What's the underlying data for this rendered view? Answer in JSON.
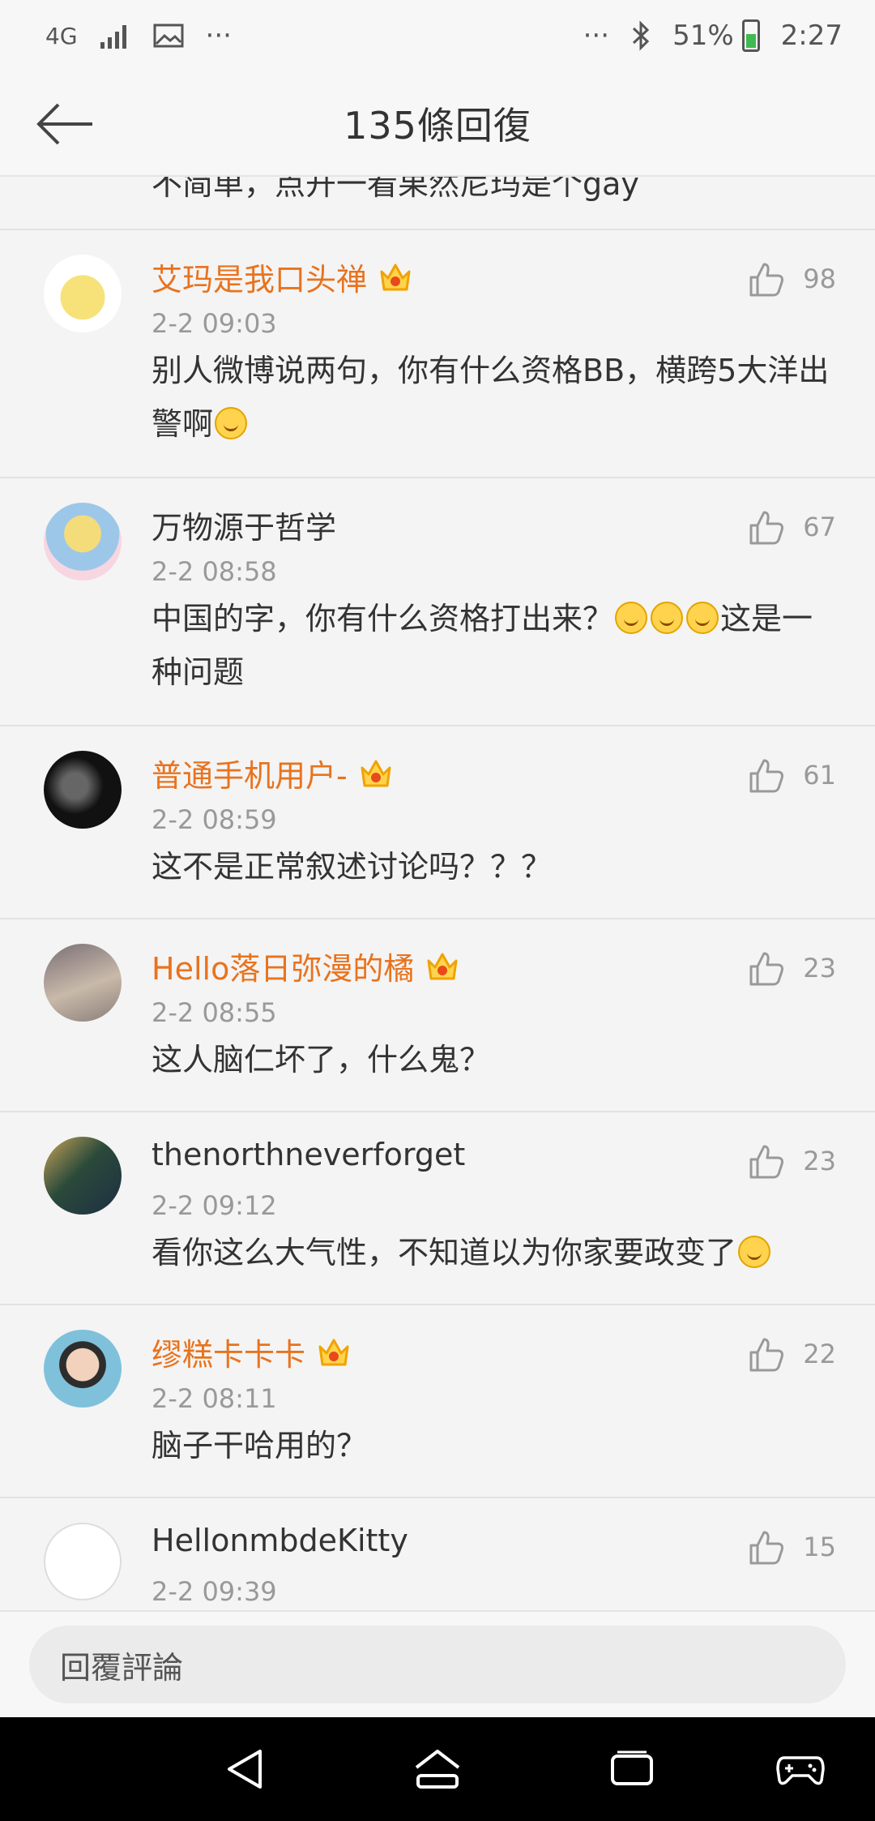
{
  "status_bar": {
    "network": "4G",
    "more_left": "···",
    "more_right": "···",
    "battery": "51%",
    "time": "2:27"
  },
  "header": {
    "title": "135條回復"
  },
  "partial_comment": {
    "text": "不简单，点开一看果然尼玛是个gay"
  },
  "comments": [
    {
      "name": "艾玛是我口头禅",
      "vip": true,
      "time": "2-2 09:03",
      "likes": "98",
      "text_a": "别人微博说两句，你有什么资格BB，横跨5大洋出警啊",
      "emojis": 1,
      "text_b": ""
    },
    {
      "name": "万物源于哲学",
      "vip": false,
      "time": "2-2 08:58",
      "likes": "67",
      "text_a": "中国的字，你有什么资格打出来？",
      "emojis": 3,
      "text_b": "这是一种问题"
    },
    {
      "name": "普通手机用户-",
      "vip": true,
      "time": "2-2 08:59",
      "likes": "61",
      "text_a": "这不是正常叙述讨论吗？？？",
      "emojis": 0,
      "text_b": ""
    },
    {
      "name": "Hello落日弥漫的橘",
      "vip": true,
      "time": "2-2 08:55",
      "likes": "23",
      "text_a": "这人脑仁坏了，什么鬼？",
      "emojis": 0,
      "text_b": ""
    },
    {
      "name": "thenorthneverforget",
      "vip": false,
      "time": "2-2 09:12",
      "likes": "23",
      "text_a": "看你这么大气性，不知道以为你家要政变了",
      "emojis": 1,
      "text_b": ""
    },
    {
      "name": "缪糕卡卡卡",
      "vip": true,
      "time": "2-2 08:11",
      "likes": "22",
      "text_a": "脑子干哈用的？",
      "emojis": 0,
      "text_b": ""
    },
    {
      "name": "HellonmbdeKitty",
      "vip": false,
      "time": "2-2 09:39",
      "likes": "15",
      "text_a": "",
      "emojis": 0,
      "text_b": ""
    }
  ],
  "reply_bar": {
    "placeholder": "回覆評論"
  },
  "colors": {
    "vip_name": "#e8731e",
    "accent_crown": "#f0a300"
  },
  "icons": [
    "signal-icon",
    "image-icon",
    "bluetooth-icon",
    "back-arrow-icon",
    "thumbs-up-icon",
    "vip-crown-icon",
    "nav-back-icon",
    "nav-home-icon",
    "nav-recents-icon",
    "gamepad-icon"
  ]
}
